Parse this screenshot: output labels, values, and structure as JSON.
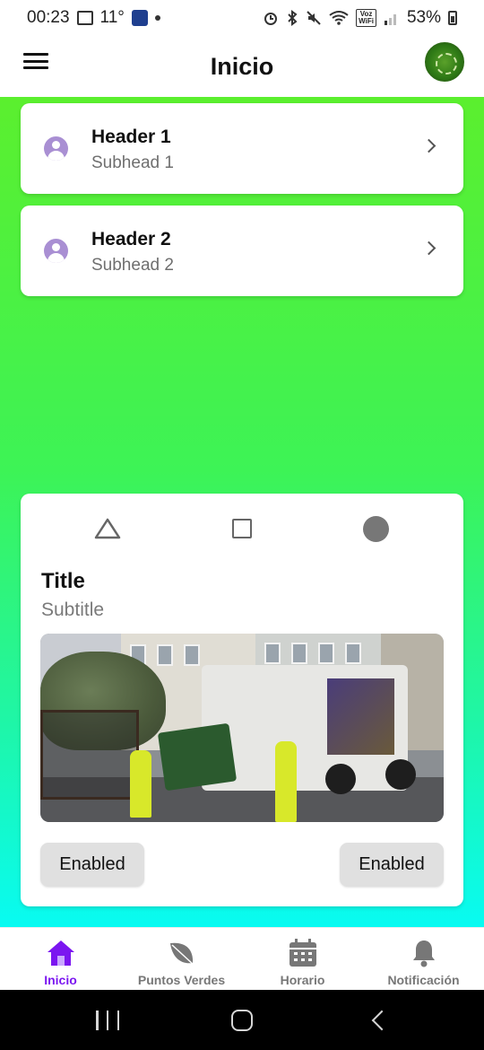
{
  "status_bar": {
    "time": "00:23",
    "temperature": "11°",
    "battery_percent": "53%",
    "voz_label": "Voz\nWiFi"
  },
  "app_bar": {
    "title": "Inicio",
    "menu_icon": "menu-icon",
    "logo_icon": "brand-logo"
  },
  "list": [
    {
      "header": "Header 1",
      "subhead": "Subhead 1",
      "icon": "person-icon"
    },
    {
      "header": "Header 2",
      "subhead": "Subhead 2",
      "icon": "person-icon"
    }
  ],
  "media_card": {
    "shapes": [
      "triangle-icon",
      "square-icon",
      "circle-icon"
    ],
    "title": "Title",
    "subtitle": "Subtitle",
    "image_alt": "garbage truck",
    "buttons": [
      "Enabled",
      "Enabled"
    ]
  },
  "bottom_nav": {
    "items": [
      {
        "label": "Inicio",
        "icon": "home-icon",
        "active": true
      },
      {
        "label": "Puntos Verdes",
        "icon": "leaf-icon",
        "active": false
      },
      {
        "label": "Horario",
        "icon": "calendar-icon",
        "active": false
      },
      {
        "label": "Notificación",
        "icon": "bell-icon",
        "active": false
      }
    ]
  },
  "colors": {
    "accent": "#7b16f0",
    "gradient_top": "#5bef2e",
    "gradient_bottom": "#08fbf2",
    "avatar": "#a98fd3"
  }
}
